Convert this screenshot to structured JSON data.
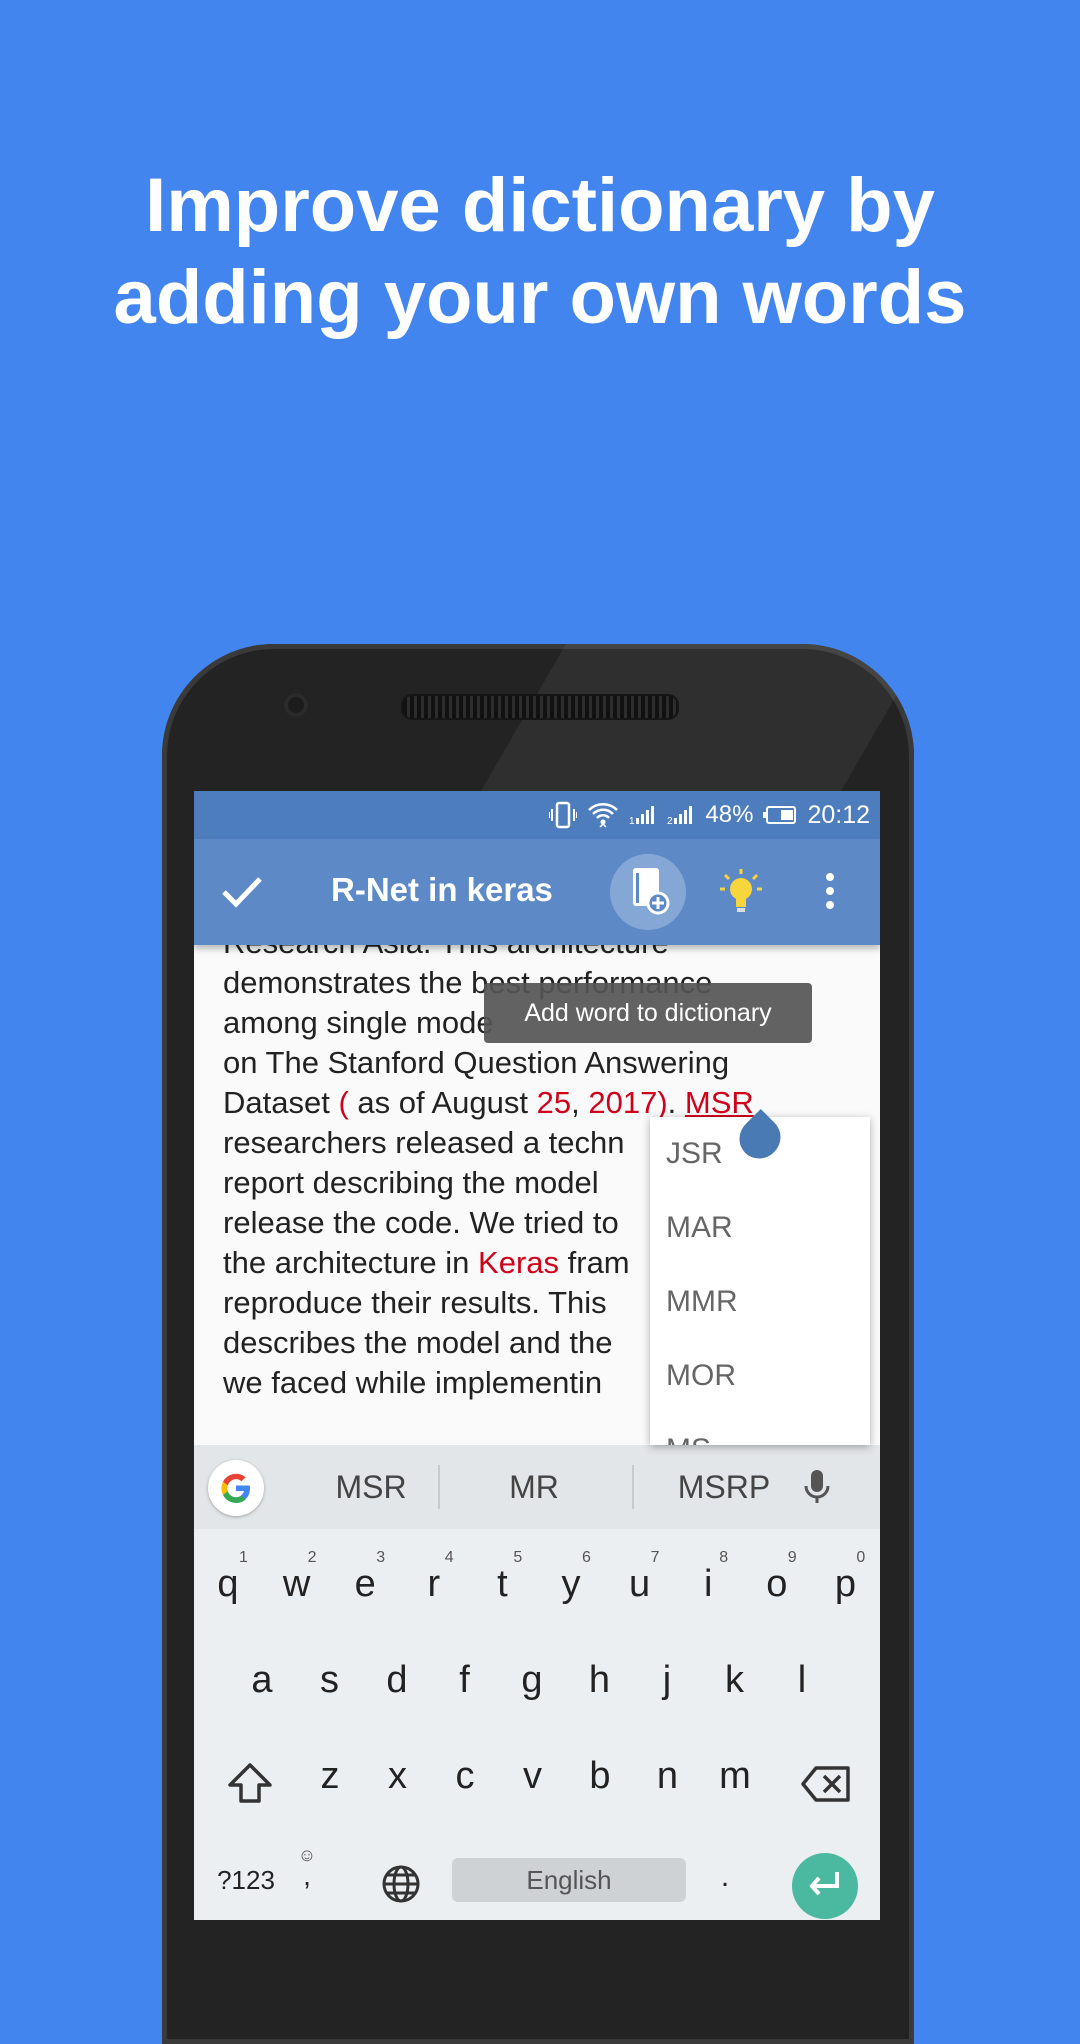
{
  "promo": {
    "headline_line1": "Improve dictionary by",
    "headline_line2": "adding your own words"
  },
  "status_bar": {
    "battery": "48%",
    "time": "20:12",
    "icons": [
      "vibrate-icon",
      "wifi-icon",
      "signal-1-icon",
      "signal-2-icon",
      "battery-icon"
    ]
  },
  "app_bar": {
    "title": "R-Net in keras",
    "icons": [
      "check-icon",
      "add-to-dictionary-icon",
      "lightbulb-icon",
      "more-vert-icon"
    ]
  },
  "editor": {
    "lines": [
      {
        "segments": [
          {
            "text": "Research Asia. This architecture",
            "style": "normal"
          }
        ]
      },
      {
        "segments": [
          {
            "text": "demonstrates the best performance",
            "style": "normal"
          }
        ]
      },
      {
        "segments": [
          {
            "text": "among single mode",
            "style": "normal"
          }
        ]
      },
      {
        "segments": [
          {
            "text": "on The Stanford Question Answering",
            "style": "normal"
          }
        ]
      },
      {
        "segments": [
          {
            "text": "Dataset ",
            "style": "normal"
          },
          {
            "text": "(",
            "style": "red"
          },
          {
            "text": " as of August ",
            "style": "normal"
          },
          {
            "text": "25",
            "style": "red"
          },
          {
            "text": ", ",
            "style": "normal"
          },
          {
            "text": "2017",
            "style": "red"
          },
          {
            "text": ")",
            "style": "red"
          },
          {
            "text": ". ",
            "style": "normal"
          },
          {
            "text": "MSR",
            "style": "red-underline"
          }
        ]
      },
      {
        "segments": [
          {
            "text": "researchers released a techn",
            "style": "normal"
          }
        ]
      },
      {
        "segments": [
          {
            "text": "report describing the model",
            "style": "normal"
          }
        ]
      },
      {
        "segments": [
          {
            "text": "release the code. We tried to",
            "style": "normal"
          }
        ]
      },
      {
        "segments": [
          {
            "text": "the architecture in ",
            "style": "normal"
          },
          {
            "text": "Keras",
            "style": "red"
          },
          {
            "text": " fram",
            "style": "normal"
          }
        ]
      },
      {
        "segments": [
          {
            "text": "reproduce their results. This",
            "style": "normal"
          }
        ]
      },
      {
        "segments": [
          {
            "text": "describes the model and the",
            "style": "normal"
          }
        ]
      },
      {
        "segments": [
          {
            "text": "we faced while implementin",
            "style": "normal"
          }
        ]
      }
    ]
  },
  "tooltip": "Add word to dictionary",
  "suggestions_popup": [
    "JSR",
    "MAR",
    "MMR",
    "MOR",
    "MS"
  ],
  "keyboard": {
    "suggestions": [
      "MSR",
      "MR",
      "MSRP"
    ],
    "row1": [
      {
        "key": "q",
        "hint": "1"
      },
      {
        "key": "w",
        "hint": "2"
      },
      {
        "key": "e",
        "hint": "3"
      },
      {
        "key": "r",
        "hint": "4"
      },
      {
        "key": "t",
        "hint": "5"
      },
      {
        "key": "y",
        "hint": "6"
      },
      {
        "key": "u",
        "hint": "7"
      },
      {
        "key": "i",
        "hint": "8"
      },
      {
        "key": "o",
        "hint": "9"
      },
      {
        "key": "p",
        "hint": "0"
      }
    ],
    "row2": [
      "a",
      "s",
      "d",
      "f",
      "g",
      "h",
      "j",
      "k",
      "l"
    ],
    "row3": [
      "z",
      "x",
      "c",
      "v",
      "b",
      "n",
      "m"
    ],
    "symbols_label": "?123",
    "comma_label": ",",
    "emoji_label": "☺",
    "space_label": "English",
    "period_label": "."
  },
  "colors": {
    "background": "#4285ef",
    "app_bar": "#5d8ac7",
    "status_bar": "#4e7dbe",
    "misspelled": "#d0021b",
    "enter_key": "#4ab9a0"
  }
}
